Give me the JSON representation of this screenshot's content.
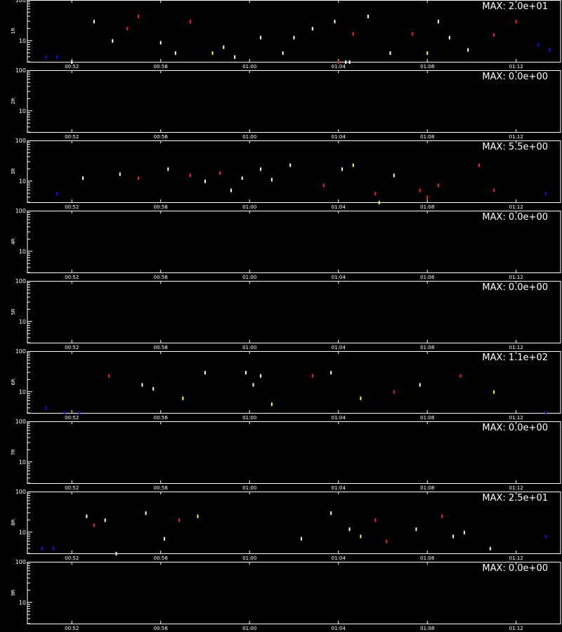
{
  "colors": {
    "background": "#000000",
    "axis": "#ffffff",
    "low": "#1010ff",
    "mid": "#ff2020",
    "high": "#ffff40",
    "top": "#ffffff"
  },
  "footer_text": "",
  "chart_data": [
    {
      "type": "heatmap",
      "panel": "1R",
      "max_label": "MAX: 2.0e+01",
      "y_ticks": [
        "100",
        "10"
      ],
      "x_ticks": [
        "00:52",
        "00:56",
        "01:00",
        "01:04",
        "01:08",
        "01:12"
      ],
      "yscale": "log",
      "ylim": [
        3,
        100
      ],
      "xlim": [
        "00:50",
        "01:14"
      ],
      "points": [
        {
          "t": "00:50:50",
          "y": 4,
          "c": "low"
        },
        {
          "t": "00:51:20",
          "y": 4,
          "c": "low"
        },
        {
          "t": "00:52:00",
          "y": 3,
          "c": "top"
        },
        {
          "t": "00:53:00",
          "y": 30,
          "c": "top"
        },
        {
          "t": "00:53:50",
          "y": 10,
          "c": "top"
        },
        {
          "t": "00:54:30",
          "y": 20,
          "c": "mid"
        },
        {
          "t": "00:55:00",
          "y": 40,
          "c": "mid"
        },
        {
          "t": "00:56:00",
          "y": 9,
          "c": "top"
        },
        {
          "t": "00:56:40",
          "y": 5,
          "c": "top"
        },
        {
          "t": "00:57:20",
          "y": 30,
          "c": "mid"
        },
        {
          "t": "00:58:20",
          "y": 5,
          "c": "high"
        },
        {
          "t": "00:58:50",
          "y": 7,
          "c": "top"
        },
        {
          "t": "00:59:20",
          "y": 4,
          "c": "top"
        },
        {
          "t": "01:00:30",
          "y": 12,
          "c": "top"
        },
        {
          "t": "01:01:30",
          "y": 5,
          "c": "top"
        },
        {
          "t": "01:02:00",
          "y": 12,
          "c": "top"
        },
        {
          "t": "01:02:50",
          "y": 20,
          "c": "top"
        },
        {
          "t": "01:03:50",
          "y": 30,
          "c": "top"
        },
        {
          "t": "01:04:00",
          "y": 3,
          "c": "mid"
        },
        {
          "t": "01:04:20",
          "y": 3,
          "c": "top"
        },
        {
          "t": "01:04:30",
          "y": 3,
          "c": "top"
        },
        {
          "t": "01:04:40",
          "y": 15,
          "c": "mid"
        },
        {
          "t": "01:05:20",
          "y": 40,
          "c": "top"
        },
        {
          "t": "01:06:20",
          "y": 5,
          "c": "top"
        },
        {
          "t": "01:07:20",
          "y": 15,
          "c": "mid"
        },
        {
          "t": "01:08:00",
          "y": 5,
          "c": "high"
        },
        {
          "t": "01:08:30",
          "y": 30,
          "c": "top"
        },
        {
          "t": "01:09:00",
          "y": 12,
          "c": "top"
        },
        {
          "t": "01:09:50",
          "y": 6,
          "c": "top"
        },
        {
          "t": "01:11:00",
          "y": 14,
          "c": "mid"
        },
        {
          "t": "01:12:00",
          "y": 30,
          "c": "mid"
        },
        {
          "t": "01:13:00",
          "y": 8,
          "c": "low"
        },
        {
          "t": "01:13:30",
          "y": 6,
          "c": "low"
        }
      ]
    },
    {
      "type": "heatmap",
      "panel": "2R",
      "max_label": "MAX: 0.0e+00",
      "y_ticks": [
        "100",
        "10"
      ],
      "x_ticks": [
        "00:52",
        "00:56",
        "01:00",
        "01:04",
        "01:08",
        "01:12"
      ],
      "yscale": "log",
      "ylim": [
        3,
        100
      ],
      "xlim": [
        "00:50",
        "01:14"
      ],
      "points": []
    },
    {
      "type": "heatmap",
      "panel": "3R",
      "max_label": "MAX: 5.5e+00",
      "y_ticks": [
        "100",
        "10"
      ],
      "x_ticks": [
        "00:52",
        "00:56",
        "01:00",
        "01:04",
        "01:08",
        "01:12"
      ],
      "yscale": "log",
      "ylim": [
        3,
        100
      ],
      "xlim": [
        "00:50",
        "01:14"
      ],
      "points": [
        {
          "t": "00:51:20",
          "y": 5,
          "c": "low"
        },
        {
          "t": "00:52:30",
          "y": 12,
          "c": "top"
        },
        {
          "t": "00:54:10",
          "y": 15,
          "c": "top"
        },
        {
          "t": "00:55:00",
          "y": 12,
          "c": "mid"
        },
        {
          "t": "00:56:20",
          "y": 20,
          "c": "top"
        },
        {
          "t": "00:57:20",
          "y": 14,
          "c": "mid"
        },
        {
          "t": "00:58:00",
          "y": 10,
          "c": "top"
        },
        {
          "t": "00:58:40",
          "y": 16,
          "c": "mid"
        },
        {
          "t": "00:59:10",
          "y": 6,
          "c": "top"
        },
        {
          "t": "00:59:40",
          "y": 12,
          "c": "top"
        },
        {
          "t": "01:00:30",
          "y": 20,
          "c": "top"
        },
        {
          "t": "01:01:00",
          "y": 11,
          "c": "top"
        },
        {
          "t": "01:01:50",
          "y": 25,
          "c": "top"
        },
        {
          "t": "01:03:20",
          "y": 8,
          "c": "mid"
        },
        {
          "t": "01:04:10",
          "y": 20,
          "c": "top"
        },
        {
          "t": "01:04:40",
          "y": 25,
          "c": "high"
        },
        {
          "t": "01:05:40",
          "y": 5,
          "c": "mid"
        },
        {
          "t": "01:05:50",
          "y": 3,
          "c": "high"
        },
        {
          "t": "01:06:30",
          "y": 14,
          "c": "top"
        },
        {
          "t": "01:07:40",
          "y": 6,
          "c": "mid"
        },
        {
          "t": "01:08:00",
          "y": 4,
          "c": "mid"
        },
        {
          "t": "01:08:30",
          "y": 8,
          "c": "mid"
        },
        {
          "t": "01:10:20",
          "y": 25,
          "c": "mid"
        },
        {
          "t": "01:11:00",
          "y": 6,
          "c": "mid"
        },
        {
          "t": "01:13:20",
          "y": 5,
          "c": "low"
        }
      ]
    },
    {
      "type": "heatmap",
      "panel": "4R",
      "max_label": "MAX: 0.0e+00",
      "y_ticks": [
        "100",
        "10"
      ],
      "x_ticks": [
        "00:52",
        "00:56",
        "01:00",
        "01:04",
        "01:08",
        "01:12"
      ],
      "yscale": "log",
      "ylim": [
        3,
        100
      ],
      "xlim": [
        "00:50",
        "01:14"
      ],
      "points": []
    },
    {
      "type": "heatmap",
      "panel": "5R",
      "max_label": "MAX: 0.0e+00",
      "y_ticks": [
        "100",
        "10"
      ],
      "x_ticks": [
        "00:52",
        "00:56",
        "01:00",
        "01:04",
        "01:08",
        "01:12"
      ],
      "yscale": "log",
      "ylim": [
        3,
        100
      ],
      "xlim": [
        "00:50",
        "01:14"
      ],
      "points": []
    },
    {
      "type": "heatmap",
      "panel": "6R",
      "max_label": "MAX: 1.1e+02",
      "y_ticks": [
        "100",
        "10"
      ],
      "x_ticks": [
        "00:52",
        "00:56",
        "01:00",
        "01:04",
        "01:08",
        "01:12"
      ],
      "yscale": "log",
      "ylim": [
        3,
        100
      ],
      "xlim": [
        "00:50",
        "01:14"
      ],
      "points": [
        {
          "t": "00:50:50",
          "y": 4,
          "c": "low"
        },
        {
          "t": "00:51:40",
          "y": 3,
          "c": "low"
        },
        {
          "t": "00:52:20",
          "y": 3,
          "c": "low"
        },
        {
          "t": "00:53:40",
          "y": 25,
          "c": "mid"
        },
        {
          "t": "00:55:10",
          "y": 15,
          "c": "top"
        },
        {
          "t": "00:55:40",
          "y": 12,
          "c": "top"
        },
        {
          "t": "00:57:00",
          "y": 7,
          "c": "high"
        },
        {
          "t": "00:58:00",
          "y": 30,
          "c": "top"
        },
        {
          "t": "00:59:50",
          "y": 30,
          "c": "top"
        },
        {
          "t": "01:00:10",
          "y": 15,
          "c": "top"
        },
        {
          "t": "01:00:30",
          "y": 25,
          "c": "top"
        },
        {
          "t": "01:01:00",
          "y": 5,
          "c": "high"
        },
        {
          "t": "01:02:50",
          "y": 25,
          "c": "mid"
        },
        {
          "t": "01:03:40",
          "y": 30,
          "c": "top"
        },
        {
          "t": "01:05:00",
          "y": 7,
          "c": "high"
        },
        {
          "t": "01:06:30",
          "y": 10,
          "c": "mid"
        },
        {
          "t": "01:07:40",
          "y": 15,
          "c": "top"
        },
        {
          "t": "01:09:30",
          "y": 25,
          "c": "mid"
        },
        {
          "t": "01:11:00",
          "y": 10,
          "c": "high"
        },
        {
          "t": "01:13:20",
          "y": 3,
          "c": "low"
        }
      ]
    },
    {
      "type": "heatmap",
      "panel": "7R",
      "max_label": "MAX: 0.0e+00",
      "y_ticks": [
        "100",
        "10"
      ],
      "x_ticks": [
        "00:52",
        "00:56",
        "01:00",
        "01:04",
        "01:08",
        "01:12"
      ],
      "yscale": "log",
      "ylim": [
        3,
        100
      ],
      "xlim": [
        "00:50",
        "01:14"
      ],
      "points": []
    },
    {
      "type": "heatmap",
      "panel": "8R",
      "max_label": "MAX: 2.5e+01",
      "y_ticks": [
        "100",
        "10"
      ],
      "x_ticks": [
        "00:52",
        "00:56",
        "01:00",
        "01:04",
        "01:08",
        "01:12"
      ],
      "yscale": "log",
      "ylim": [
        3,
        100
      ],
      "xlim": [
        "00:50",
        "01:14"
      ],
      "points": [
        {
          "t": "00:50:40",
          "y": 4,
          "c": "low"
        },
        {
          "t": "00:51:10",
          "y": 4,
          "c": "low"
        },
        {
          "t": "00:52:40",
          "y": 25,
          "c": "top"
        },
        {
          "t": "00:53:00",
          "y": 15,
          "c": "mid"
        },
        {
          "t": "00:53:30",
          "y": 20,
          "c": "top"
        },
        {
          "t": "00:54:00",
          "y": 3,
          "c": "top"
        },
        {
          "t": "00:55:20",
          "y": 30,
          "c": "top"
        },
        {
          "t": "00:56:10",
          "y": 7,
          "c": "top"
        },
        {
          "t": "00:56:50",
          "y": 20,
          "c": "mid"
        },
        {
          "t": "00:57:40",
          "y": 25,
          "c": "high"
        },
        {
          "t": "01:02:20",
          "y": 7,
          "c": "top"
        },
        {
          "t": "01:03:40",
          "y": 30,
          "c": "top"
        },
        {
          "t": "01:04:30",
          "y": 12,
          "c": "top"
        },
        {
          "t": "01:05:00",
          "y": 8,
          "c": "high"
        },
        {
          "t": "01:05:40",
          "y": 20,
          "c": "mid"
        },
        {
          "t": "01:06:10",
          "y": 6,
          "c": "mid"
        },
        {
          "t": "01:07:30",
          "y": 12,
          "c": "top"
        },
        {
          "t": "01:08:40",
          "y": 25,
          "c": "mid"
        },
        {
          "t": "01:09:10",
          "y": 8,
          "c": "top"
        },
        {
          "t": "01:09:40",
          "y": 10,
          "c": "top"
        },
        {
          "t": "01:10:50",
          "y": 4,
          "c": "high"
        },
        {
          "t": "01:13:20",
          "y": 8,
          "c": "low"
        }
      ]
    },
    {
      "type": "heatmap",
      "panel": "9R",
      "max_label": "MAX: 0.0e+00",
      "y_ticks": [
        "100",
        "10"
      ],
      "x_ticks": [
        "00:52",
        "00:56",
        "01:00",
        "01:04",
        "01:08",
        "01:12"
      ],
      "yscale": "log",
      "ylim": [
        3,
        100
      ],
      "xlim": [
        "00:50",
        "01:14"
      ],
      "points": []
    }
  ]
}
